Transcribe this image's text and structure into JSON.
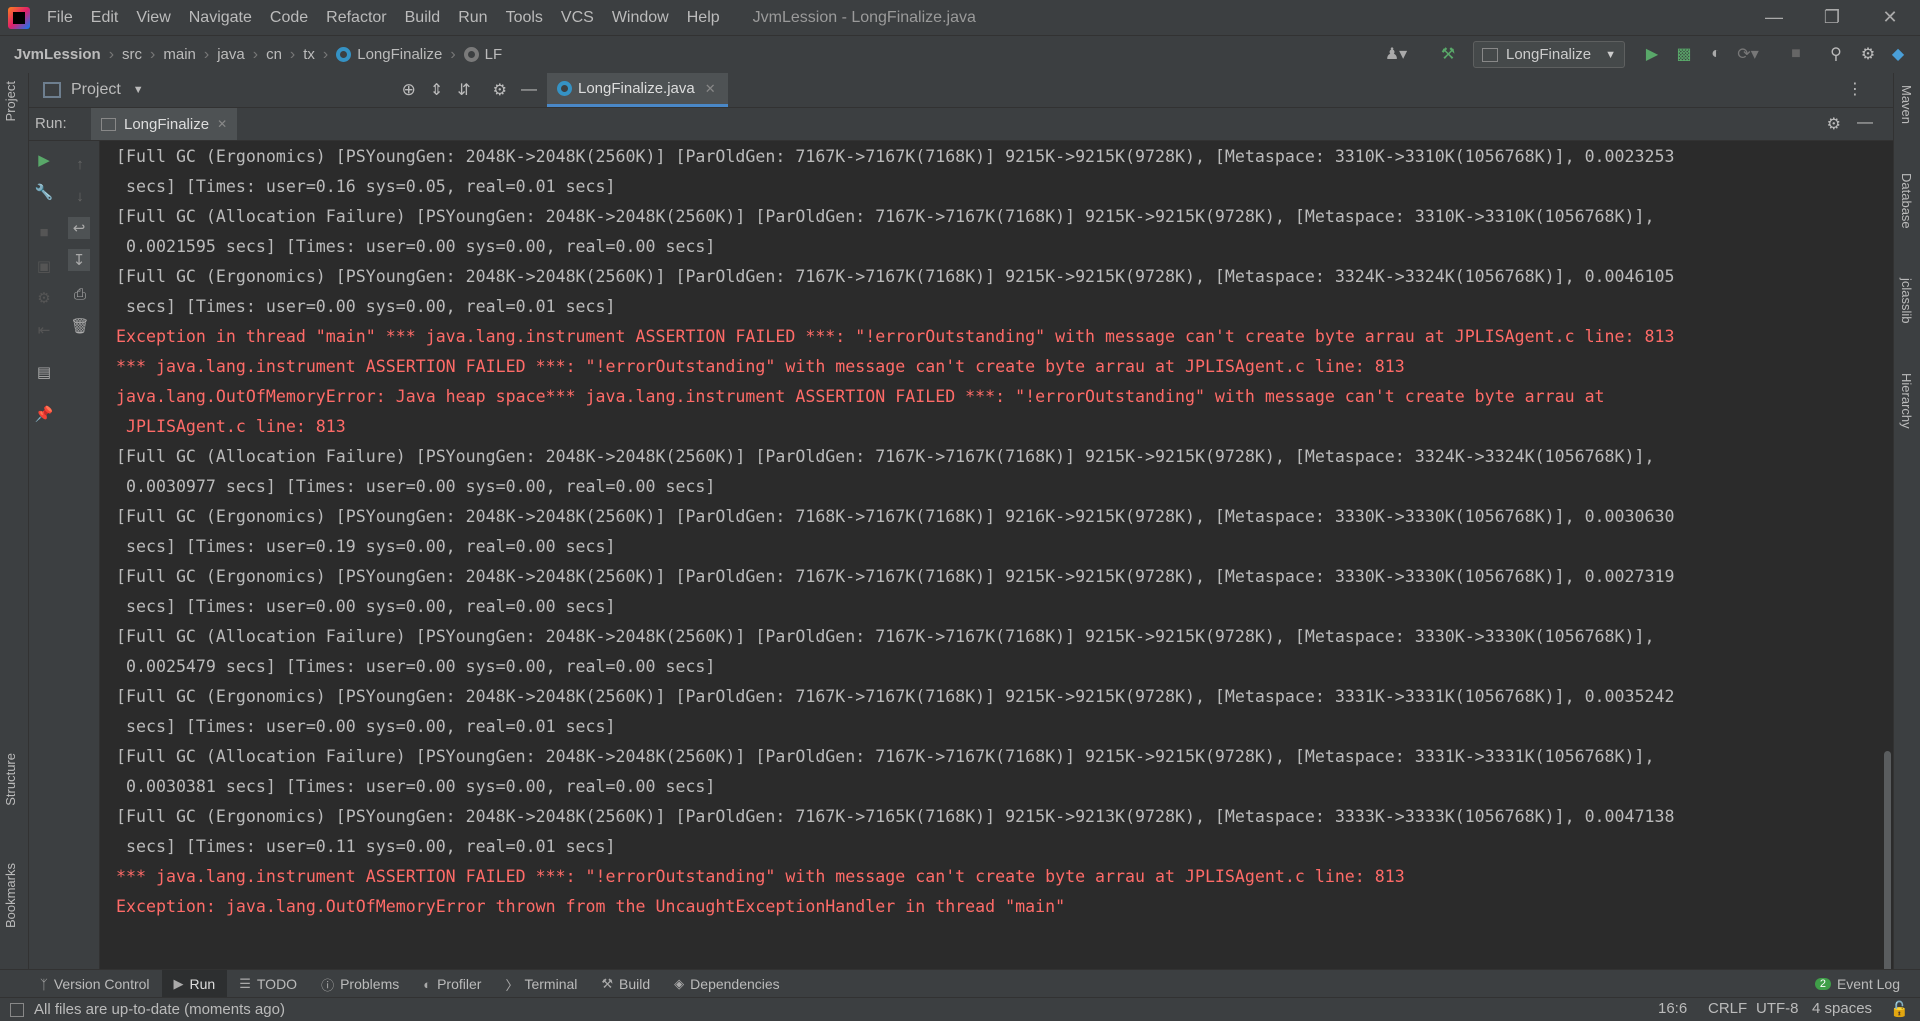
{
  "menubar": {
    "items": [
      "File",
      "Edit",
      "View",
      "Navigate",
      "Code",
      "Refactor",
      "Build",
      "Run",
      "Tools",
      "VCS",
      "Window",
      "Help"
    ],
    "window_title": "JvmLession - LongFinalize.java"
  },
  "breadcrumbs": [
    "JvmLession",
    "src",
    "main",
    "java",
    "cn",
    "tx",
    "LongFinalize",
    "LF"
  ],
  "run_config": "LongFinalize",
  "project_panel": {
    "title": "Project"
  },
  "editor_tab": {
    "label": "LongFinalize.java"
  },
  "run_panel": {
    "label": "Run:",
    "tab": "LongFinalize"
  },
  "left_stripe": {
    "project": "Project",
    "structure": "Structure",
    "bookmarks": "Bookmarks"
  },
  "right_stripe": {
    "maven": "Maven",
    "database": "Database",
    "jclasslib": "jclasslib",
    "hierarchy": "Hierarchy"
  },
  "console": {
    "lines": [
      {
        "text": "[Full GC (Ergonomics) [PSYoungGen: 2048K->2048K(2560K)] [ParOldGen: 7167K->7167K(7168K)] 9215K->9215K(9728K), [Metaspace: 3310K->3310K(1056768K)], 0.0023253",
        "err": false
      },
      {
        "text": " secs] [Times: user=0.16 sys=0.05, real=0.01 secs]",
        "err": false
      },
      {
        "text": "[Full GC (Allocation Failure) [PSYoungGen: 2048K->2048K(2560K)] [ParOldGen: 7167K->7167K(7168K)] 9215K->9215K(9728K), [Metaspace: 3310K->3310K(1056768K)],",
        "err": false
      },
      {
        "text": " 0.0021595 secs] [Times: user=0.00 sys=0.00, real=0.00 secs]",
        "err": false
      },
      {
        "text": "[Full GC (Ergonomics) [PSYoungGen: 2048K->2048K(2560K)] [ParOldGen: 7167K->7167K(7168K)] 9215K->9215K(9728K), [Metaspace: 3324K->3324K(1056768K)], 0.0046105",
        "err": false
      },
      {
        "text": " secs] [Times: user=0.00 sys=0.00, real=0.01 secs]",
        "err": false
      },
      {
        "text": "Exception in thread \"main\" *** java.lang.instrument ASSERTION FAILED ***: \"!errorOutstanding\" with message can't create byte arrau at JPLISAgent.c line: 813",
        "err": true
      },
      {
        "text": "*** java.lang.instrument ASSERTION FAILED ***: \"!errorOutstanding\" with message can't create byte arrau at JPLISAgent.c line: 813",
        "err": true
      },
      {
        "text": "java.lang.OutOfMemoryError: Java heap space*** java.lang.instrument ASSERTION FAILED ***: \"!errorOutstanding\" with message can't create byte arrau at",
        "err": true
      },
      {
        "text": " JPLISAgent.c line: 813",
        "err": true
      },
      {
        "text": "[Full GC (Allocation Failure) [PSYoungGen: 2048K->2048K(2560K)] [ParOldGen: 7167K->7167K(7168K)] 9215K->9215K(9728K), [Metaspace: 3324K->3324K(1056768K)],",
        "err": false
      },
      {
        "text": " 0.0030977 secs] [Times: user=0.00 sys=0.00, real=0.00 secs]",
        "err": false
      },
      {
        "text": "[Full GC (Ergonomics) [PSYoungGen: 2048K->2048K(2560K)] [ParOldGen: 7168K->7167K(7168K)] 9216K->9215K(9728K), [Metaspace: 3330K->3330K(1056768K)], 0.0030630",
        "err": false
      },
      {
        "text": " secs] [Times: user=0.19 sys=0.00, real=0.00 secs]",
        "err": false
      },
      {
        "text": "[Full GC (Ergonomics) [PSYoungGen: 2048K->2048K(2560K)] [ParOldGen: 7167K->7167K(7168K)] 9215K->9215K(9728K), [Metaspace: 3330K->3330K(1056768K)], 0.0027319",
        "err": false
      },
      {
        "text": " secs] [Times: user=0.00 sys=0.00, real=0.00 secs]",
        "err": false
      },
      {
        "text": "[Full GC (Allocation Failure) [PSYoungGen: 2048K->2048K(2560K)] [ParOldGen: 7167K->7167K(7168K)] 9215K->9215K(9728K), [Metaspace: 3330K->3330K(1056768K)],",
        "err": false
      },
      {
        "text": " 0.0025479 secs] [Times: user=0.00 sys=0.00, real=0.00 secs]",
        "err": false
      },
      {
        "text": "[Full GC (Ergonomics) [PSYoungGen: 2048K->2048K(2560K)] [ParOldGen: 7167K->7167K(7168K)] 9215K->9215K(9728K), [Metaspace: 3331K->3331K(1056768K)], 0.0035242",
        "err": false
      },
      {
        "text": " secs] [Times: user=0.00 sys=0.00, real=0.01 secs]",
        "err": false
      },
      {
        "text": "[Full GC (Allocation Failure) [PSYoungGen: 2048K->2048K(2560K)] [ParOldGen: 7167K->7167K(7168K)] 9215K->9215K(9728K), [Metaspace: 3331K->3331K(1056768K)],",
        "err": false
      },
      {
        "text": " 0.0030381 secs] [Times: user=0.00 sys=0.00, real=0.00 secs]",
        "err": false
      },
      {
        "text": "[Full GC (Ergonomics) [PSYoungGen: 2048K->2048K(2560K)] [ParOldGen: 7167K->7165K(7168K)] 9215K->9213K(9728K), [Metaspace: 3333K->3333K(1056768K)], 0.0047138",
        "err": false
      },
      {
        "text": " secs] [Times: user=0.11 sys=0.00, real=0.01 secs]",
        "err": false
      },
      {
        "text": "*** java.lang.instrument ASSERTION FAILED ***: \"!errorOutstanding\" with message can't create byte arrau at JPLISAgent.c line: 813",
        "err": true
      },
      {
        "text": "",
        "err": true
      },
      {
        "text": "Exception: java.lang.OutOfMemoryError thrown from the UncaughtExceptionHandler in thread \"main\"",
        "err": true
      }
    ]
  },
  "bottom_tabs": [
    "Version Control",
    "Run",
    "TODO",
    "Problems",
    "Profiler",
    "Terminal",
    "Build",
    "Dependencies"
  ],
  "event_log": {
    "count": "2",
    "label": "Event Log"
  },
  "status": {
    "message": "All files are up-to-date (moments ago)",
    "position": "16:6",
    "line_sep": "CRLF",
    "encoding": "UTF-8",
    "indent": "4 spaces"
  },
  "colors": {
    "bg": "#2b2b2b",
    "panel": "#3c3f41",
    "error": "#ff6b68",
    "accent": "#4a88c7"
  }
}
